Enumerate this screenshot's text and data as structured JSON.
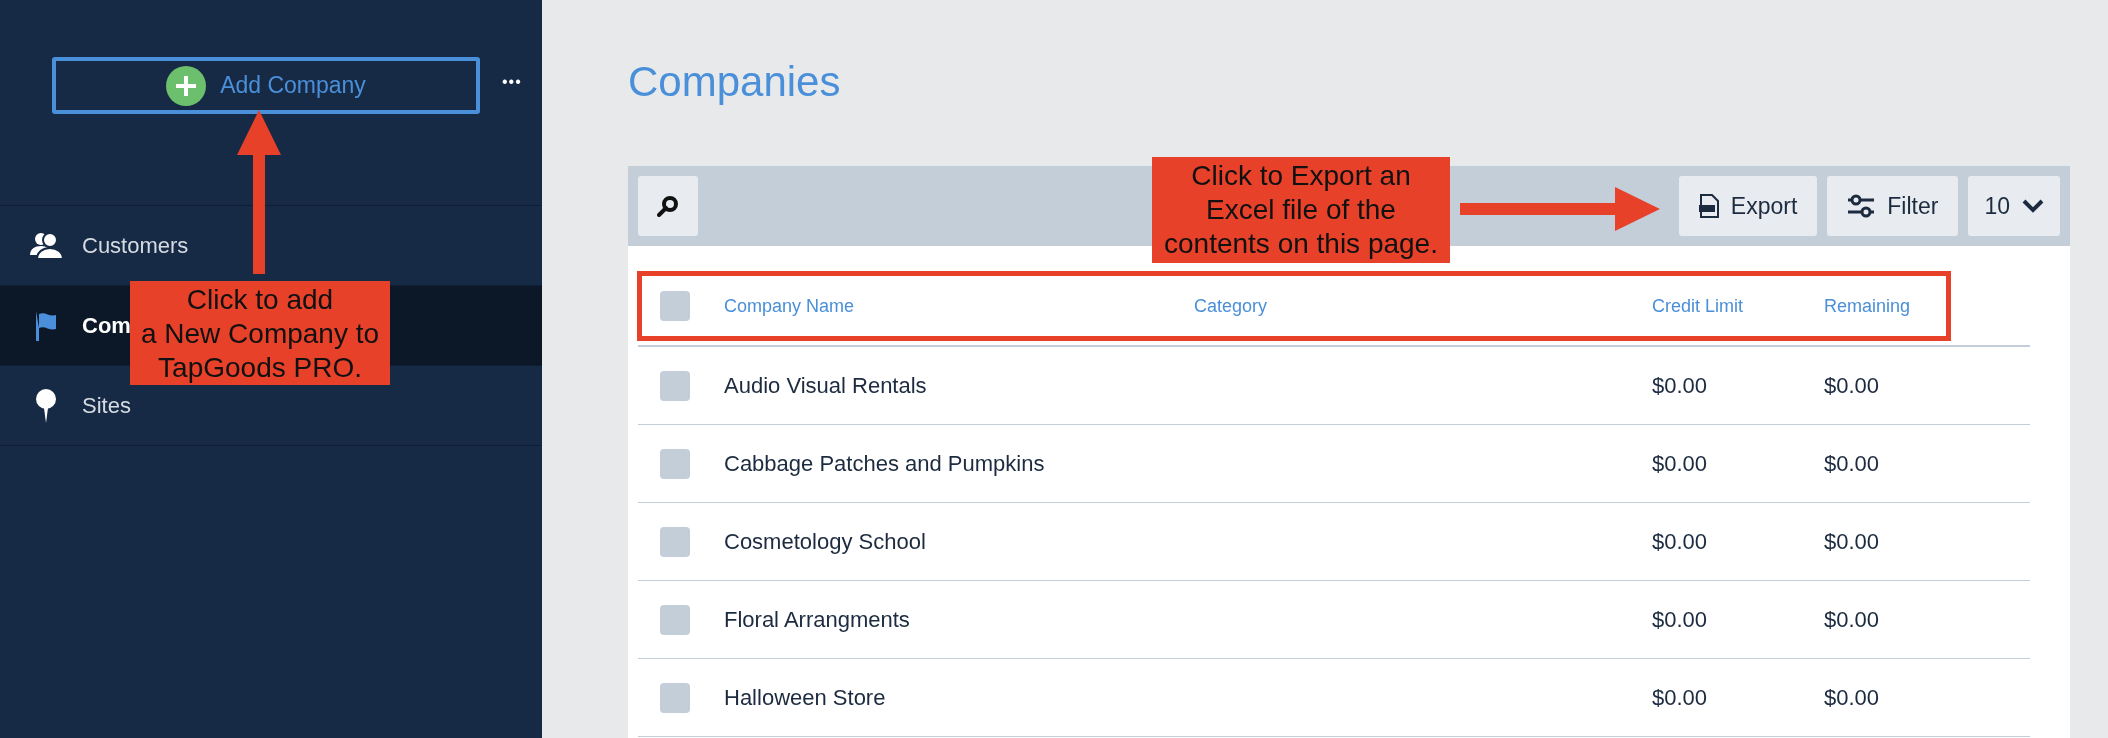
{
  "sidebar": {
    "add_button": {
      "label": "Add Company"
    },
    "more": "•••",
    "items": [
      {
        "label": "Customers",
        "kind": "people",
        "selected": false
      },
      {
        "label": "Com",
        "kind": "flag",
        "selected": true
      },
      {
        "label": "Sites",
        "kind": "pin",
        "selected": false
      }
    ]
  },
  "page": {
    "title": "Companies"
  },
  "toolbar": {
    "export": "Export",
    "filter": "Filter",
    "per_page": "10"
  },
  "table": {
    "columns": [
      "Company Name",
      "Category",
      "Credit Limit",
      "Remaining"
    ],
    "header_checked": false,
    "rows": [
      {
        "name": "Audio Visual Rentals",
        "credit_limit": "$0.00",
        "remaining": "$0.00",
        "checked": false
      },
      {
        "name": "Cabbage Patches and Pumpkins",
        "credit_limit": "$0.00",
        "remaining": "$0.00",
        "checked": false
      },
      {
        "name": "Cosmetology School",
        "credit_limit": "$0.00",
        "remaining": "$0.00",
        "checked": false
      },
      {
        "name": "Floral Arrangments",
        "credit_limit": "$0.00",
        "remaining": "$0.00",
        "checked": false
      },
      {
        "name": "Halloween Store",
        "credit_limit": "$0.00",
        "remaining": "$0.00",
        "checked": false
      }
    ]
  },
  "callouts": [
    {
      "kind": "up",
      "text": "Click to add\na New Company to\nTapGoods PRO."
    },
    {
      "kind": "right",
      "text": "Click to Export an\nExcel file of the\ncontents on this page."
    }
  ]
}
